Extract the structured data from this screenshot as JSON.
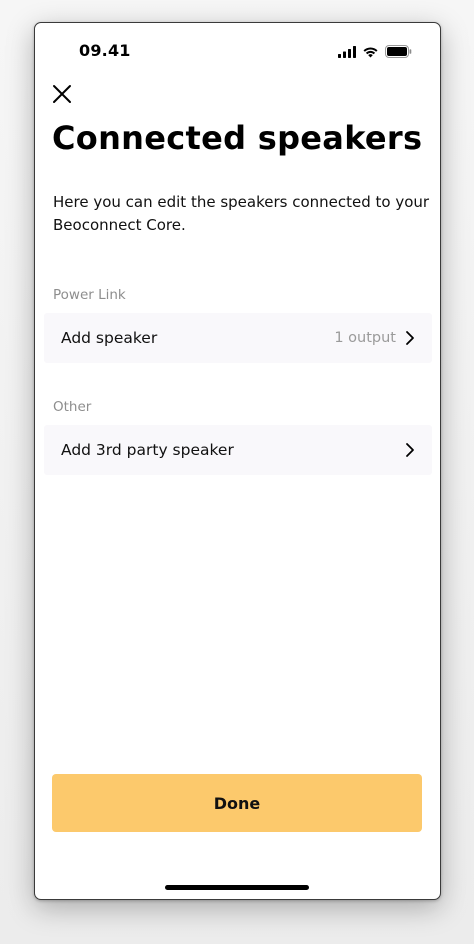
{
  "status_bar": {
    "time": "09.41",
    "icons": [
      "cellular-signal-icon",
      "wifi-icon",
      "battery-icon"
    ]
  },
  "header": {
    "close_icon": "close-icon",
    "title": "Connected speakers"
  },
  "description": "Here you can edit the speakers connected to your Beoconnect Core.",
  "sections": [
    {
      "label": "Power Link",
      "items": [
        {
          "label": "Add speaker",
          "value": "1 output",
          "icon": "chevron-right-icon"
        }
      ]
    },
    {
      "label": "Other",
      "items": [
        {
          "label": "Add 3rd party speaker",
          "value": "",
          "icon": "chevron-right-icon"
        }
      ]
    }
  ],
  "footer": {
    "done_label": "Done"
  },
  "colors": {
    "accent": "#fcc96c",
    "row_background": "#f9f8fb",
    "section_label": "#8e8e8e",
    "secondary_value": "#9a9a9a"
  }
}
